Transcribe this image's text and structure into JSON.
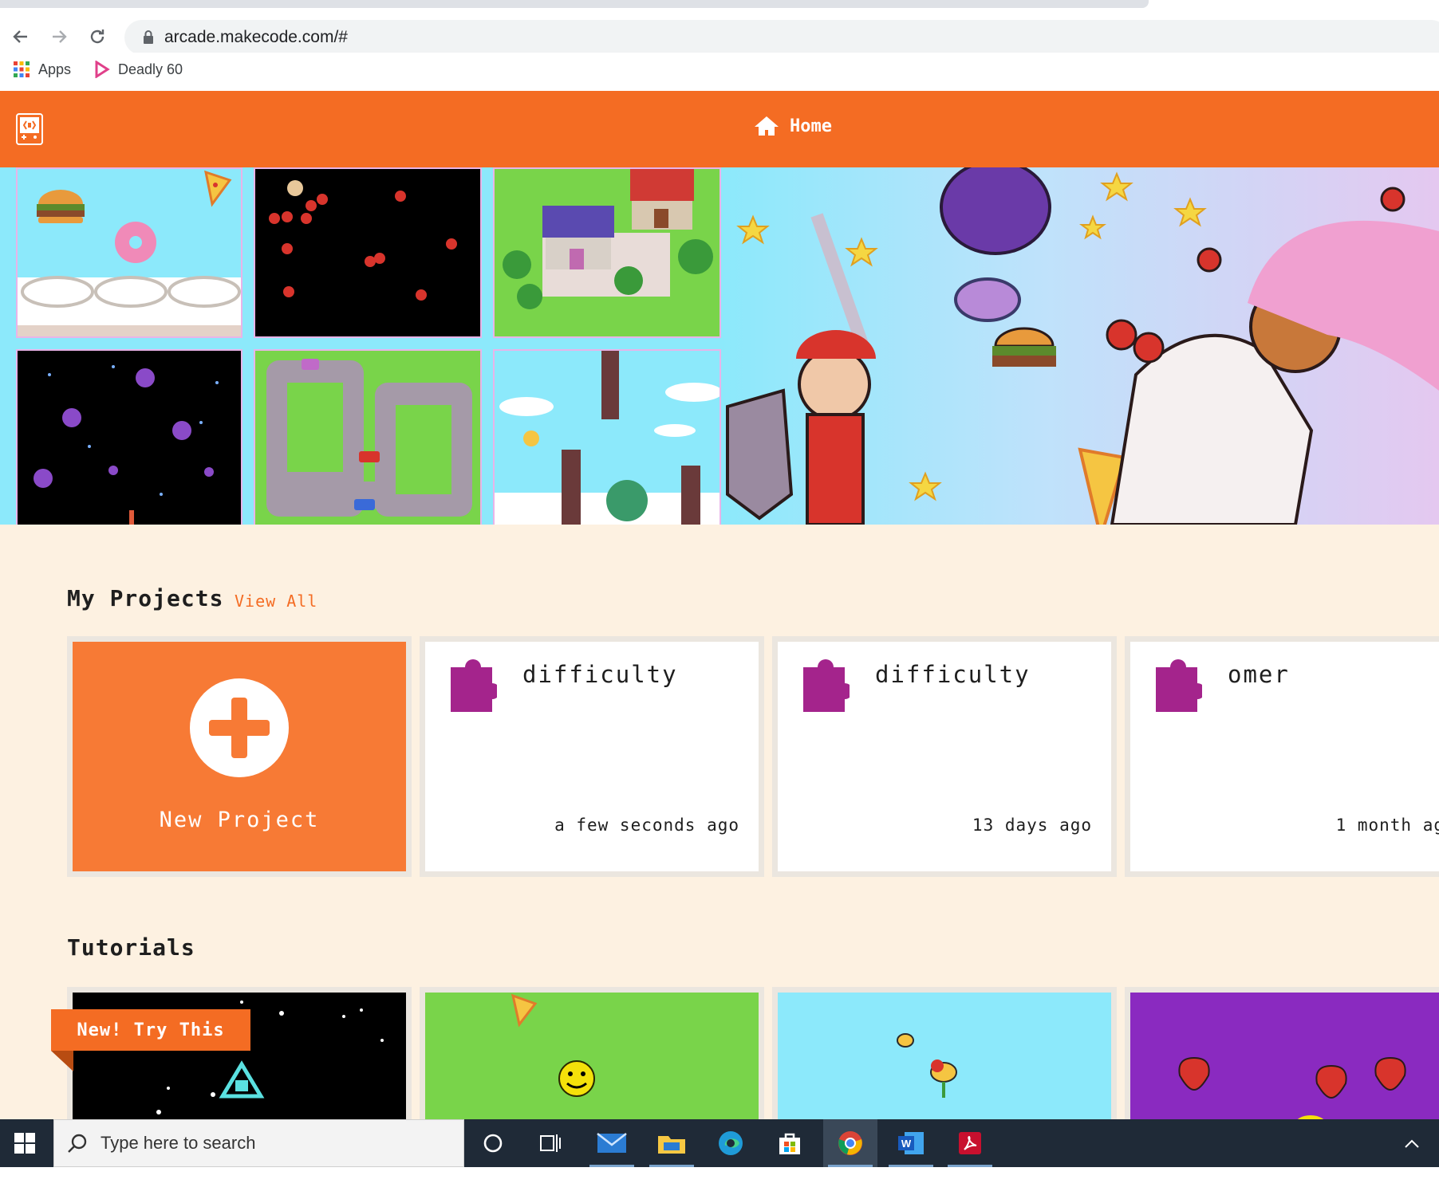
{
  "browser": {
    "url": "arcade.makecode.com/#",
    "bookmarks": [
      {
        "label": "Apps",
        "icon": "apps-grid-icon"
      },
      {
        "label": "Deadly 60",
        "icon": "deadly60-icon"
      }
    ]
  },
  "header": {
    "home_label": "Home",
    "brand_color": "#f46c23"
  },
  "projects": {
    "title": "My Projects",
    "view_all": "View All",
    "new_project_label": "New Project",
    "items": [
      {
        "name": "difficulty",
        "time": "a few seconds ago"
      },
      {
        "name": "difficulty",
        "time": "13 days ago"
      },
      {
        "name": "omer",
        "time": "1 month ag"
      }
    ]
  },
  "tutorials": {
    "title": "Tutorials",
    "badge": "New! Try This"
  },
  "taskbar": {
    "search_placeholder": "Type here to search"
  }
}
